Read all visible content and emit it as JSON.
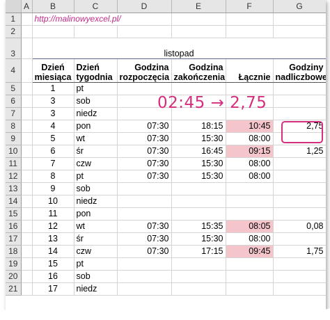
{
  "columns": [
    "A",
    "B",
    "C",
    "D",
    "E",
    "F",
    "G"
  ],
  "link": "http://malinowyexcel.pl/",
  "title": "listopad",
  "headers": {
    "b": [
      "Dzień",
      "miesiąca"
    ],
    "c": [
      "Dzień",
      "tygodnia"
    ],
    "d": [
      "Godzina",
      "rozpoczęcia"
    ],
    "e": [
      "Godzina",
      "zakończenia"
    ],
    "f": "Łącznie",
    "g": [
      "Godziny",
      "nadliczbowe"
    ]
  },
  "annotation": "02:45 → 2,75",
  "row_numbers": [
    "1",
    "2",
    "3",
    "4",
    "5",
    "6",
    "7",
    "8",
    "9",
    "10",
    "11",
    "12",
    "13",
    "14",
    "15",
    "16",
    "17",
    "18",
    "19",
    "20",
    "21"
  ],
  "rows": [
    {
      "row": "5",
      "day": "1",
      "weekday": "pt",
      "start": "",
      "end": "",
      "total": "",
      "overtime": "",
      "pink": false
    },
    {
      "row": "6",
      "day": "3",
      "weekday": "sob",
      "start": "",
      "end": "",
      "total": "",
      "overtime": "",
      "pink": false
    },
    {
      "row": "7",
      "day": "3",
      "weekday": "niedz",
      "start": "",
      "end": "",
      "total": "",
      "overtime": "",
      "pink": false
    },
    {
      "row": "8",
      "day": "4",
      "weekday": "pon",
      "start": "07:30",
      "end": "18:15",
      "total": "10:45",
      "overtime": "2,75",
      "pink": true
    },
    {
      "row": "9",
      "day": "5",
      "weekday": "wt",
      "start": "07:30",
      "end": "15:30",
      "total": "08:00",
      "overtime": "",
      "pink": false
    },
    {
      "row": "10",
      "day": "6",
      "weekday": "śr",
      "start": "07:30",
      "end": "16:45",
      "total": "09:15",
      "overtime": "1,25",
      "pink": true
    },
    {
      "row": "11",
      "day": "7",
      "weekday": "czw",
      "start": "07:30",
      "end": "15:30",
      "total": "08:00",
      "overtime": "",
      "pink": false
    },
    {
      "row": "12",
      "day": "8",
      "weekday": "pt",
      "start": "07:30",
      "end": "15:30",
      "total": "08:00",
      "overtime": "",
      "pink": false
    },
    {
      "row": "13",
      "day": "9",
      "weekday": "sob",
      "start": "",
      "end": "",
      "total": "",
      "overtime": "",
      "pink": false
    },
    {
      "row": "14",
      "day": "10",
      "weekday": "niedz",
      "start": "",
      "end": "",
      "total": "",
      "overtime": "",
      "pink": false
    },
    {
      "row": "15",
      "day": "11",
      "weekday": "pon",
      "start": "",
      "end": "",
      "total": "",
      "overtime": "",
      "pink": false
    },
    {
      "row": "16",
      "day": "12",
      "weekday": "wt",
      "start": "07:30",
      "end": "15:35",
      "total": "08:05",
      "overtime": "0,08",
      "pink": true
    },
    {
      "row": "17",
      "day": "13",
      "weekday": "śr",
      "start": "07:30",
      "end": "15:30",
      "total": "08:00",
      "overtime": "",
      "pink": false
    },
    {
      "row": "18",
      "day": "14",
      "weekday": "czw",
      "start": "07:30",
      "end": "17:15",
      "total": "09:45",
      "overtime": "1,75",
      "pink": true
    },
    {
      "row": "19",
      "day": "15",
      "weekday": "pt",
      "start": "",
      "end": "",
      "total": "",
      "overtime": "",
      "pink": false
    },
    {
      "row": "20",
      "day": "16",
      "weekday": "sob",
      "start": "",
      "end": "",
      "total": "",
      "overtime": "",
      "pink": false
    },
    {
      "row": "21",
      "day": "17",
      "weekday": "niedz",
      "start": "",
      "end": "",
      "total": "",
      "overtime": "",
      "pink": false
    }
  ],
  "colors": {
    "pink_fill": "#f4c6cc",
    "annotation": "#d62e7e",
    "title": "#2a4a7a",
    "header_fill": "#e6e6e6"
  }
}
